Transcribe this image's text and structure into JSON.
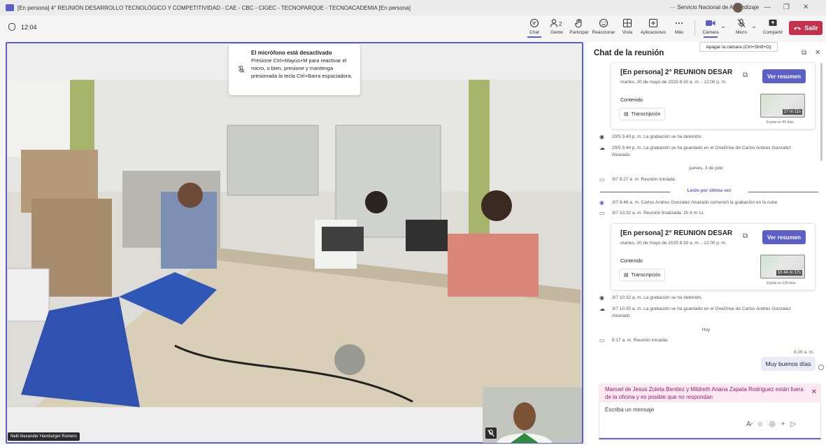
{
  "titlebar": {
    "title": "[En persona] 4° REUNIÓN DESARROLLO TECNOLÓGICO Y COMPETITIVIDAD - CAE - CBC - CIGEC - TECNOPARQUE - TECNOACADEMIA [En persona]",
    "org": "··· Servicio Nacional de Aprendizaje",
    "minimize": "—",
    "restore": "❐",
    "close": "✕"
  },
  "toolbar": {
    "timer": "12:04",
    "chat": "Chat",
    "people": "Gente",
    "people_count": "2",
    "raise": "Participar",
    "react": "Reaccionar",
    "view": "Vista",
    "apps": "Aplicaciones",
    "more": "Más",
    "camera": "Cámara",
    "mic": "Micro",
    "share": "Compartir",
    "leave": "Salir",
    "camera_tooltip": "Apagar la cámara (Ctrl+Shift+O)"
  },
  "mic_toast": {
    "title": "El micrófono está desactivado",
    "body": "Presione Ctrl+Mayús+M para reactivar el micro, o bien, presione y mantenga presionada la tecla Ctrl+Barra espaciadora."
  },
  "stage": {
    "participant_name": "Neill Alexander Hamburger Romero"
  },
  "chat": {
    "title": "Chat de la reunión",
    "cards": [
      {
        "title": "[En persona] 2° REUNIÓN DESARROLL...",
        "date": "martes, 20 de mayo de 2025 8:30 a. m. - 12:00 p. m.",
        "button": "Ver resumen",
        "content_label": "Contenido",
        "transcript": "Transcripción",
        "duration": "27 m 11s",
        "expires": "Expira en 95 días"
      },
      {
        "title": "[En persona] 2° REUNIÓN DESARROLL...",
        "date": "martes, 20 de mayo de 2025 8:30 a. m. - 12:00 p. m.",
        "button": "Ver resumen",
        "content_label": "Contenido",
        "transcript": "Transcripción",
        "duration": "1h 44 m 17s",
        "expires": "Expira en 138 días"
      }
    ],
    "events": [
      "20/5 5:43 p. m.   La grabación se ha detenido.",
      "20/5 5:44 p. m.   La grabación se ha guardado en el OneDrive de Carlos Andres Gonzalez Alvarado",
      "3/7 8:27 a. m.   Reunión iniciada:",
      "3/7 8:46 a. m.   Carlos Andres Gonzalez Alvarado comenzó la grabación en la nube",
      "3/7 10:32 a. m.   Reunión finalizada: 2h 6 m 1s",
      "3/7 10:32 a. m.   La grabación se ha detenido.",
      "3/7 10:35 a. m.   La grabación se ha guardado en el OneDrive de Carlos Andres Gonzalez Alvarado",
      "8:17 a. m.   Reunión iniciada:"
    ],
    "day_thursday": "jueves, 3 de julio",
    "day_today": "Hoy",
    "read_marker": "Leído por última vez",
    "msg_time": "8:26 a. m.",
    "msg_text": "Muy buenos días",
    "ooo_warning": "Manuel de Jesus Zuleta Benitez y Mildreth Ariana Zapata Rodriguez están fuera de la oficina y es posible que no respondan",
    "compose_placeholder": "Escriba un mensaje"
  },
  "colors": {
    "accent": "#5b5fc7",
    "leave": "#c4314b",
    "warning_bg": "#fbe9f2",
    "warning_text": "#9b1c6c"
  }
}
